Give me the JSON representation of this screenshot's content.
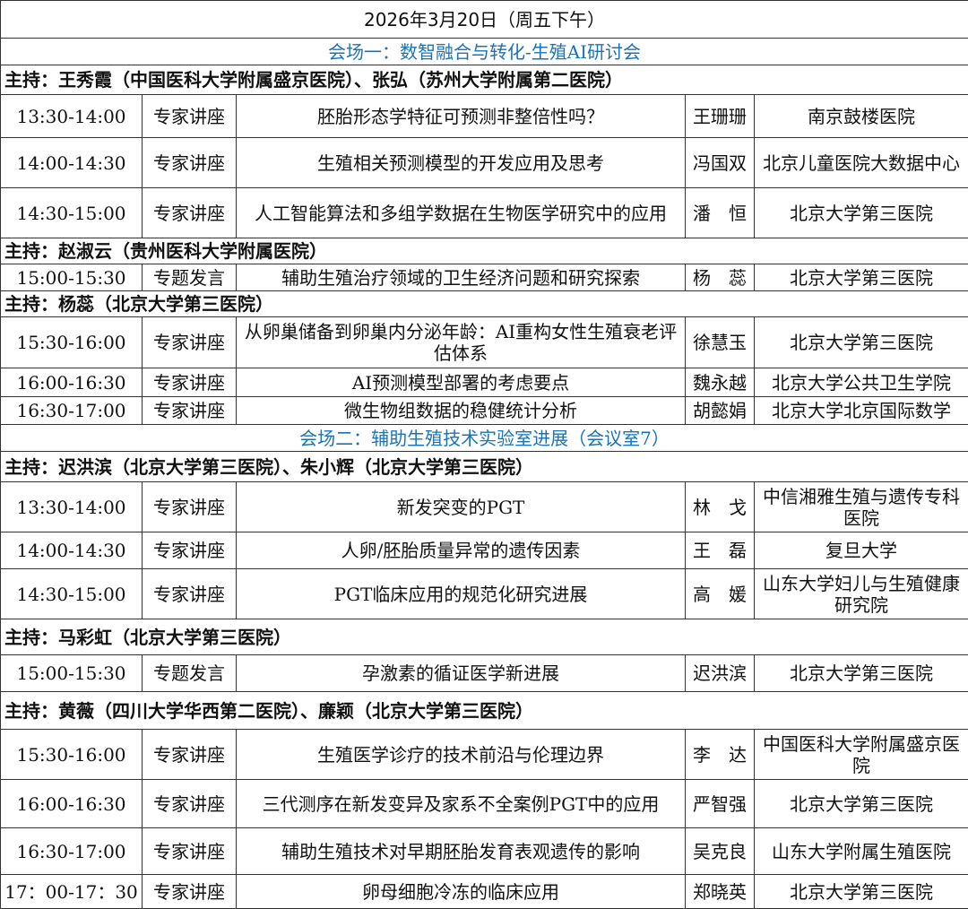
{
  "date_header": "2026年3月20日（周五下午）",
  "sections": [
    {
      "venue": "会场一：数智融合与转化-生殖AI研讨会",
      "blocks": [
        {
          "host": "主持：王秀霞（中国医科大学附属盛京医院）、张弘（苏州大学附属第二医院）",
          "rows": [
            {
              "time": "13:30-14:00",
              "type": "专家讲座",
              "topic": "胚胎形态学特征可预测非整倍性吗？",
              "speaker": "王珊珊",
              "institution": "南京鼓楼医院"
            },
            {
              "time": "14:00-14:30",
              "type": "专家讲座",
              "topic": "生殖相关预测模型的开发应用及思考",
              "speaker": "冯国双",
              "institution": "北京儿童医院大数据中心"
            },
            {
              "time": "14:30-15:00",
              "type": "专家讲座",
              "topic": "人工智能算法和多组学数据在生物医学研究中的应用",
              "speaker": "潘　恒",
              "institution": "北京大学第三医院"
            }
          ]
        },
        {
          "host": "主持：赵淑云（贵州医科大学附属医院）",
          "rows": [
            {
              "time": "15:00-15:30",
              "type": "专题发言",
              "topic": "辅助生殖治疗领域的卫生经济问题和研究探索",
              "speaker": "杨　蕊",
              "institution": "北京大学第三医院"
            }
          ]
        },
        {
          "host": "主持：杨蕊（北京大学第三医院）",
          "rows": [
            {
              "time": "15:30-16:00",
              "type": "专家讲座",
              "topic": "从卵巢储备到卵巢内分泌年龄：AI重构女性生殖衰老评估体系",
              "speaker": "徐慧玉",
              "institution": "北京大学第三医院"
            },
            {
              "time": "16:00-16:30",
              "type": "专家讲座",
              "topic": "AI预测模型部署的考虑要点",
              "speaker": "魏永越",
              "institution": "北京大学公共卫生学院"
            },
            {
              "time": "16:30-17:00",
              "type": "专家讲座",
              "topic": "微生物组数据的稳健统计分析",
              "speaker": "胡懿娟",
              "institution": "北京大学北京国际数学"
            }
          ]
        }
      ]
    },
    {
      "venue": "会场二：辅助生殖技术实验室进展（会议室7）",
      "blocks": [
        {
          "host": "主持：迟洪滨（北京大学第三医院）、朱小辉（北京大学第三医院）",
          "rows": [
            {
              "time": "13:30-14:00",
              "type": "专家讲座",
              "topic": "新发突变的PGT",
              "speaker": "林　戈",
              "institution": "中信湘雅生殖与遗传专科医院"
            },
            {
              "time": "14:00-14:30",
              "type": "专家讲座",
              "topic": "人卵/胚胎质量异常的遗传因素",
              "speaker": "王　磊",
              "institution": "复旦大学"
            },
            {
              "time": "14:30-15:00",
              "type": "专家讲座",
              "topic": "PGT临床应用的规范化研究进展",
              "speaker": "高　媛",
              "institution": "山东大学妇儿与生殖健康研究院"
            }
          ]
        },
        {
          "host": "主持：马彩虹（北京大学第三医院）",
          "rows": [
            {
              "time": "15:00-15:30",
              "type": "专题发言",
              "topic": "孕激素的循证医学新进展",
              "speaker": "迟洪滨",
              "institution": "北京大学第三医院"
            }
          ]
        },
        {
          "host": "主持：黄薇（四川大学华西第二医院）、廉颖（北京大学第三医院）",
          "rows": [
            {
              "time": "15:30-16:00",
              "type": "专家讲座",
              "topic": "生殖医学诊疗的技术前沿与伦理边界",
              "speaker": "李　达",
              "institution": "中国医科大学附属盛京医院"
            },
            {
              "time": "16:00-16:30",
              "type": "专家讲座",
              "topic": "三代测序在新发变异及家系不全案例PGT中的应用",
              "speaker": "严智强",
              "institution": "北京大学第三医院"
            },
            {
              "time": "16:30-17:00",
              "type": "专家讲座",
              "topic": "辅助生殖技术对早期胚胎发育表观遗传的影响",
              "speaker": "吴克良",
              "institution": "山东大学附属生殖医院"
            },
            {
              "time": "17：00-17：30",
              "type": "专家讲座",
              "topic": "卵母细胞冷冻的临床应用",
              "speaker": "郑晓英",
              "institution": "北京大学第三医院"
            }
          ]
        }
      ]
    }
  ]
}
